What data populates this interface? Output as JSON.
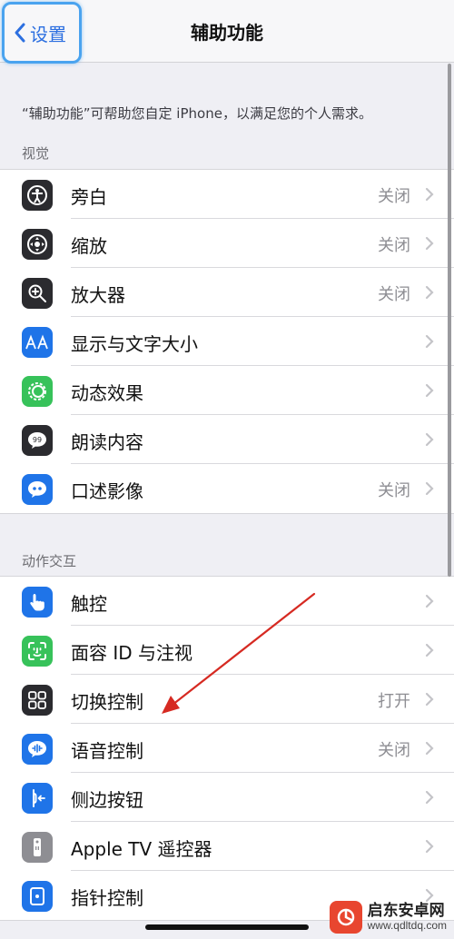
{
  "nav": {
    "back_label": "设置",
    "title": "辅助功能"
  },
  "description": "“辅助功能”可帮助您自定 iPhone，以满足您的个人需求。",
  "sections": {
    "vision": {
      "header": "视觉",
      "rows": [
        {
          "label": "旁白",
          "value": "关闭",
          "icon": "voiceover-icon",
          "color": "#2b2b2f"
        },
        {
          "label": "缩放",
          "value": "关闭",
          "icon": "zoom-icon",
          "color": "#2b2b2f"
        },
        {
          "label": "放大器",
          "value": "关闭",
          "icon": "magnifier-icon",
          "color": "#2b2b2f"
        },
        {
          "label": "显示与文字大小",
          "value": "",
          "icon": "text-size-icon",
          "color": "#1f74e8"
        },
        {
          "label": "动态效果",
          "value": "",
          "icon": "motion-icon",
          "color": "#37c25a"
        },
        {
          "label": "朗读内容",
          "value": "",
          "icon": "spoken-content-icon",
          "color": "#2b2b2f"
        },
        {
          "label": "口述影像",
          "value": "关闭",
          "icon": "audio-description-icon",
          "color": "#1f74e8"
        }
      ]
    },
    "interaction": {
      "header": "动作交互",
      "rows": [
        {
          "label": "触控",
          "value": "",
          "icon": "touch-icon",
          "color": "#1f74e8"
        },
        {
          "label": "面容 ID 与注视",
          "value": "",
          "icon": "face-id-icon",
          "color": "#37c25a"
        },
        {
          "label": "切换控制",
          "value": "打开",
          "icon": "switch-control-icon",
          "color": "#2b2b2f"
        },
        {
          "label": "语音控制",
          "value": "关闭",
          "icon": "voice-control-icon",
          "color": "#1f74e8"
        },
        {
          "label": "侧边按钮",
          "value": "",
          "icon": "side-button-icon",
          "color": "#1f74e8"
        },
        {
          "label": "Apple TV 遥控器",
          "value": "",
          "icon": "apple-tv-remote-icon",
          "color": "#8e8e93"
        },
        {
          "label": "指针控制",
          "value": "",
          "icon": "pointer-control-icon",
          "color": "#1f74e8"
        }
      ]
    }
  },
  "watermark": {
    "name": "启东安卓网",
    "url": "www.qdltdq.com"
  },
  "colors": {
    "accent": "#2c6fe0",
    "arrow": "#d62a22"
  }
}
